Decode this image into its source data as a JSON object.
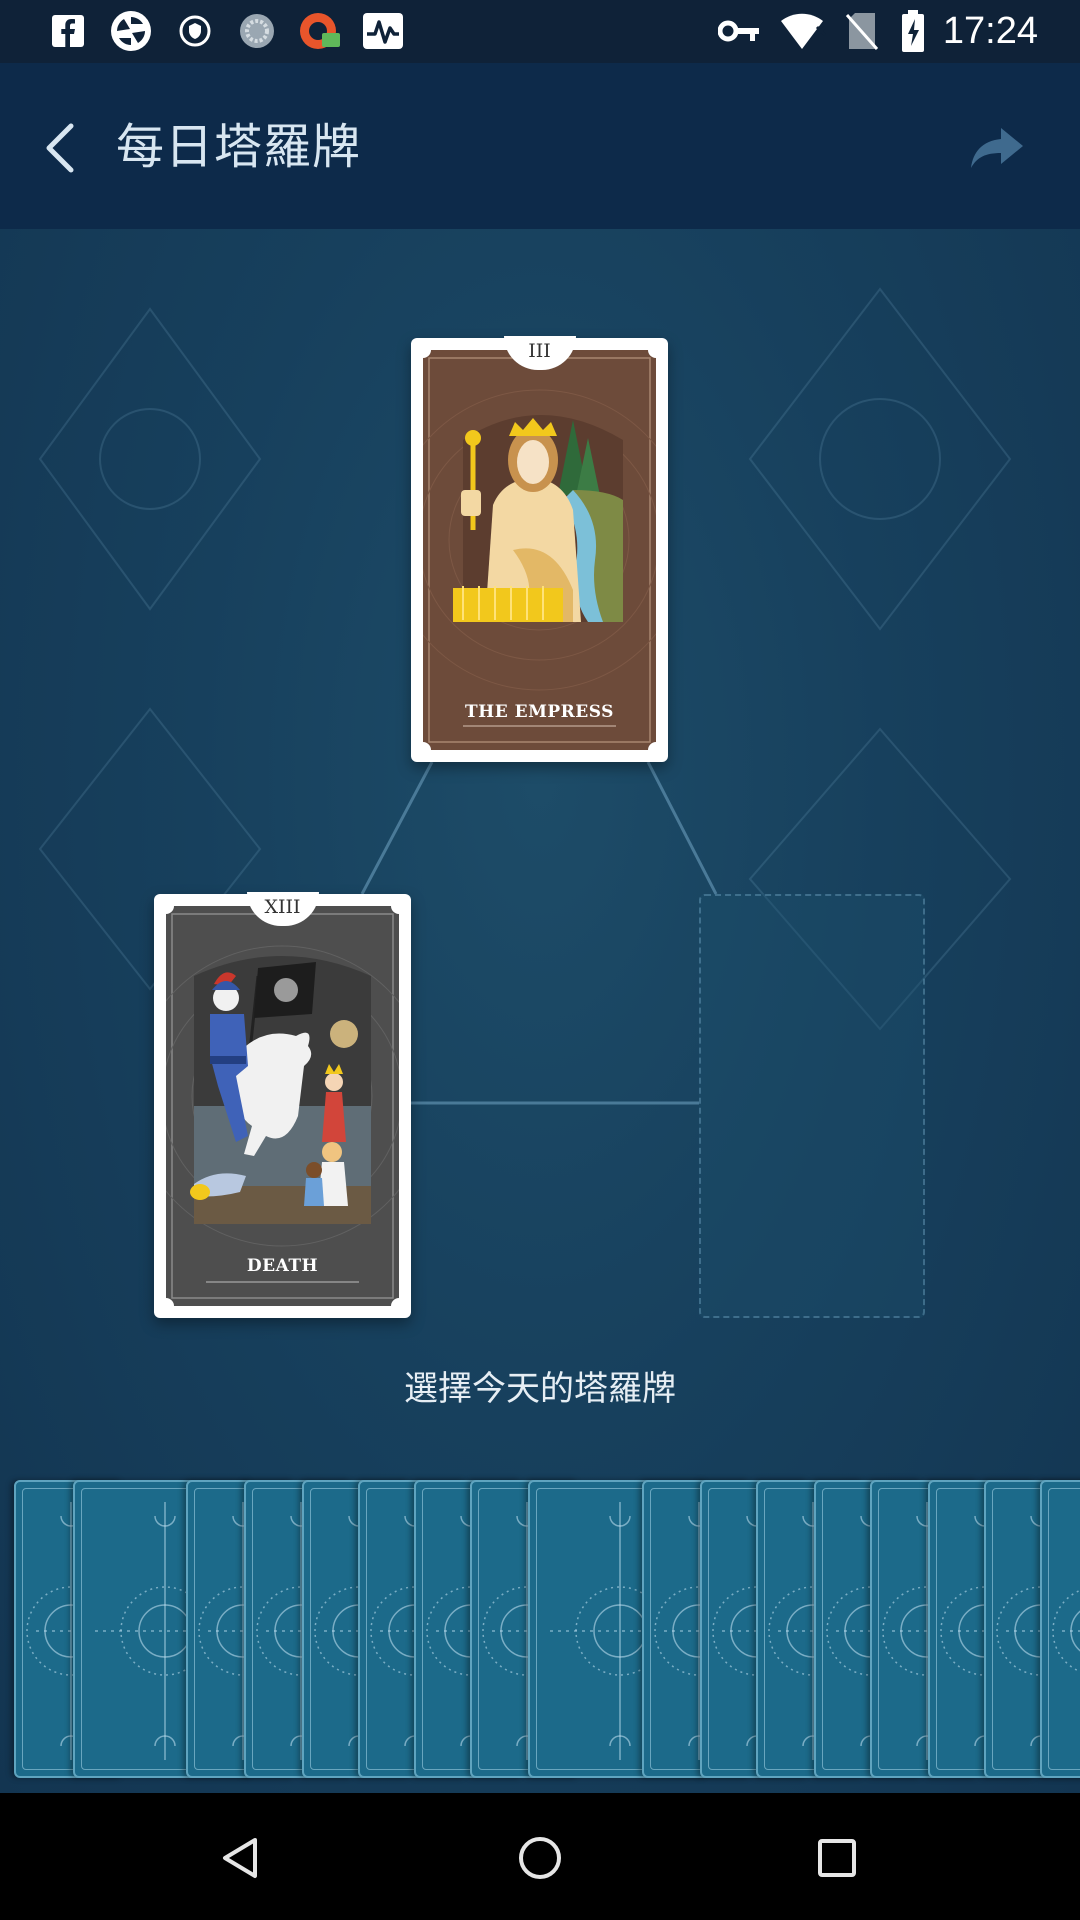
{
  "status_bar": {
    "time": "17:24",
    "left_icons": [
      "facebook-icon",
      "camera-app-icon",
      "vpn-shield-icon",
      "sync-icon",
      "app-notification-icon",
      "pulse-app-icon"
    ],
    "right_icons": [
      "vpn-key-icon",
      "wifi-icon",
      "no-sim-icon",
      "battery-charging-icon"
    ]
  },
  "header": {
    "title": "每日塔羅牌",
    "back_icon": "chevron-left-icon",
    "share_icon": "share-arrow-icon"
  },
  "spread": {
    "cards": [
      {
        "numeral": "III",
        "name": "THE EMPRESS"
      },
      {
        "numeral": "XIII",
        "name": "DEATH"
      }
    ],
    "empty_slot": "card-slot"
  },
  "prompt": "選擇今天的塔羅牌",
  "deck": {
    "count": 19,
    "back_motif": "sun-moon"
  },
  "nav": {
    "back_icon": "triangle-back-icon",
    "home_icon": "circle-home-icon",
    "recents_icon": "square-recents-icon"
  },
  "colors": {
    "header_bg": "#0d2a4a",
    "main_bg": "#17405d",
    "deck_card": "#1c6a8a",
    "empress_card": "#6d4b3a",
    "death_card": "#4e4e4e"
  }
}
